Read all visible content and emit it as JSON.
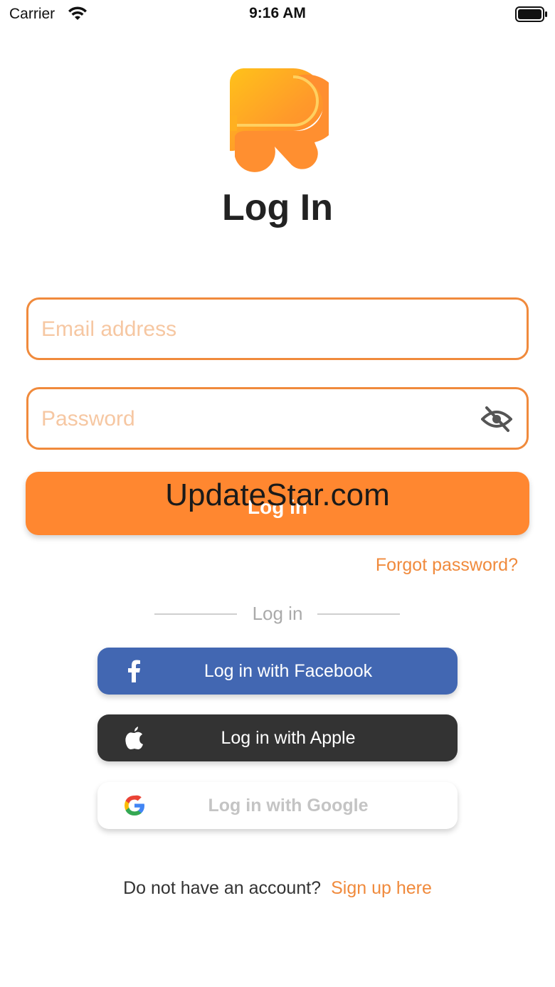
{
  "status_bar": {
    "carrier": "Carrier",
    "time": "9:16 AM",
    "wifi_icon": "wifi-icon",
    "battery_icon": "battery-icon"
  },
  "header": {
    "logo_icon": "app-logo",
    "title": "Log In"
  },
  "form": {
    "email": {
      "placeholder": "Email address",
      "value": ""
    },
    "password": {
      "placeholder": "Password",
      "value": "",
      "toggle_icon": "eye-off-icon"
    },
    "login_button_label": "Log in",
    "forgot_password": "Forgot password?"
  },
  "watermark": "UpdateStar.com",
  "divider": {
    "label": "Log in"
  },
  "social": {
    "facebook": {
      "label": "Log in with Facebook",
      "icon": "facebook-icon",
      "color": "#4267b2"
    },
    "apple": {
      "label": "Log in with Apple",
      "icon": "apple-icon",
      "color": "#333333"
    },
    "google": {
      "label": "Log in with Google",
      "icon": "google-icon",
      "color": "#ffffff"
    }
  },
  "footer": {
    "prompt": "Do not have an account?",
    "signup_link": "Sign up here"
  },
  "colors": {
    "accent": "#ff8730",
    "border": "#f08a3c",
    "placeholder": "#f6c7a2"
  }
}
